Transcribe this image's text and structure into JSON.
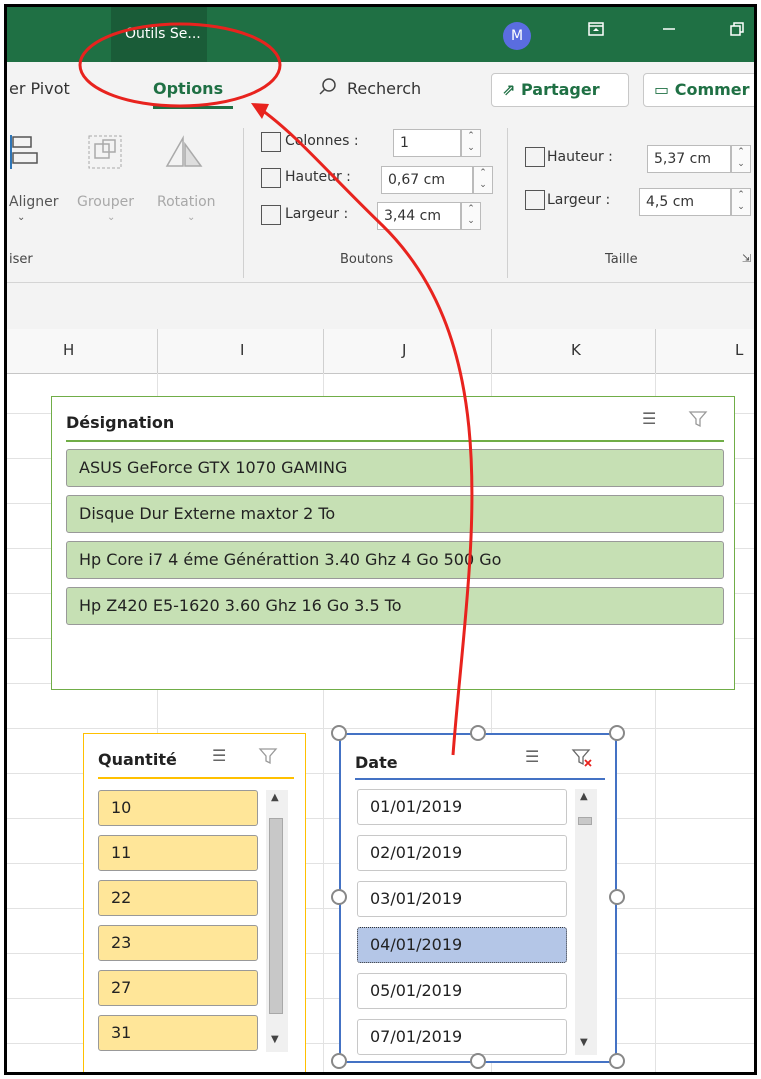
{
  "titlebar": {
    "context_tab": "Outils Se...",
    "avatar_initial": "M",
    "accent_color": "#1f7044"
  },
  "ribbon_tabs": {
    "pivot": "er Pivot",
    "options": "Options",
    "search": "Recherch",
    "share": "Partager",
    "comment": "Commer"
  },
  "arrange": {
    "align": "Aligner",
    "group": "Grouper",
    "rotate": "Rotation",
    "group_label": "iser"
  },
  "buttons": {
    "columns_label": "Colonnes :",
    "columns_value": "1",
    "height_label": "Hauteur :",
    "height_value": "0,67 cm",
    "width_label": "Largeur :",
    "width_value": "3,44 cm",
    "group_label": "Boutons"
  },
  "size": {
    "height_label": "Hauteur :",
    "height_value": "5,37 cm",
    "width_label": "Largeur :",
    "width_value": "4,5 cm",
    "group_label": "Taille"
  },
  "columns": [
    "H",
    "I",
    "J",
    "K",
    "L"
  ],
  "slicer_designation": {
    "title": "Désignation",
    "items": [
      "ASUS GeForce GTX 1070 GAMING",
      "Disque Dur Externe maxtor 2 To",
      "Hp Core i7 4 éme Générattion 3.40 Ghz 4 Go 500 Go",
      "Hp Z420 E5-1620 3.60 Ghz 16 Go 3.5 To"
    ],
    "border_color": "#70ad47",
    "item_color": "#c6e0b4"
  },
  "slicer_quantite": {
    "title": "Quantité",
    "items": [
      "10",
      "11",
      "22",
      "23",
      "27",
      "31"
    ],
    "border_color": "#ffc000",
    "item_color": "#ffe699"
  },
  "slicer_date": {
    "title": "Date",
    "items": [
      "01/01/2019",
      "02/01/2019",
      "03/01/2019",
      "04/01/2019",
      "05/01/2019",
      "07/01/2019"
    ],
    "selected": "04/01/2019",
    "border_color": "#4472c4"
  },
  "annotation_color": "#e8231e"
}
